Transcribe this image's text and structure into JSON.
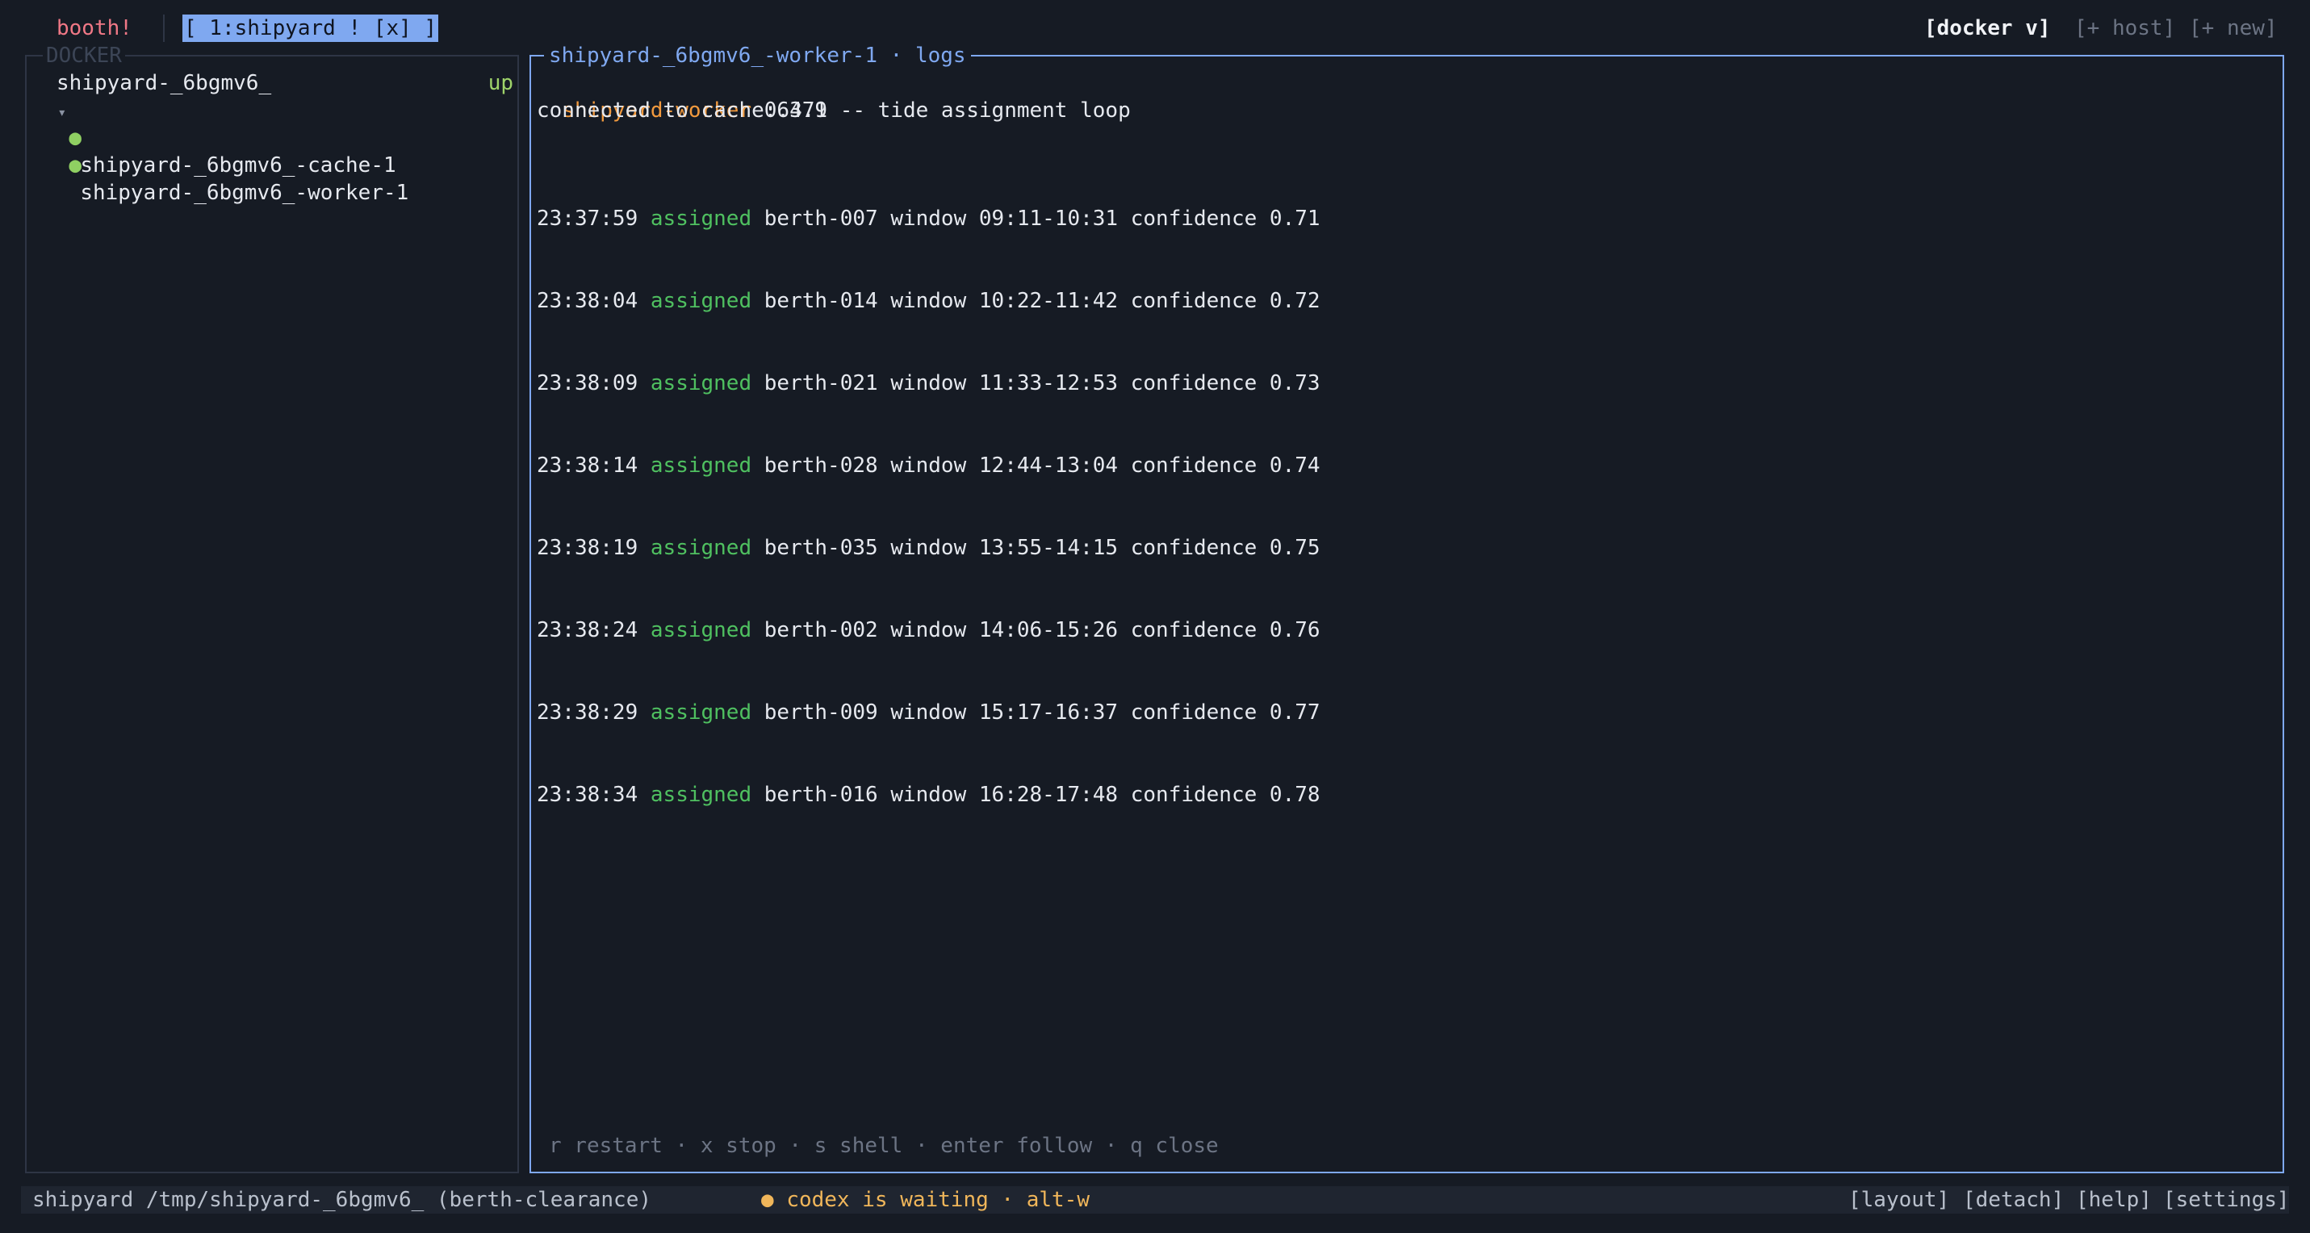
{
  "topbar": {
    "brand": "booth!",
    "active_tab": "[ 1:shipyard ! [x] ]",
    "docker_menu": "[docker v]",
    "add_host": "[+ host]",
    "add_new": "[+ new]"
  },
  "sidebar": {
    "section_title": "DOCKER",
    "project": {
      "name": "shipyard-_6bgmv6_",
      "status": "up",
      "arrow": "▾"
    },
    "containers": [
      {
        "name": "shipyard-_6bgmv6_-cache-1",
        "dot": "●"
      },
      {
        "name": "shipyard-_6bgmv6_-worker-1",
        "dot": "●"
      }
    ]
  },
  "logs": {
    "title": "shipyard-_6bgmv6_-worker-1 · logs",
    "header_app": "shipyard-worker",
    "header_rest": " 0.4.1 -- tide assignment loop",
    "connected": "connected to cache:6379",
    "entries": [
      {
        "time": "23:37:59",
        "action": "assigned",
        "rest": "berth-007 window 09:11-10:31 confidence 0.71"
      },
      {
        "time": "23:38:04",
        "action": "assigned",
        "rest": "berth-014 window 10:22-11:42 confidence 0.72"
      },
      {
        "time": "23:38:09",
        "action": "assigned",
        "rest": "berth-021 window 11:33-12:53 confidence 0.73"
      },
      {
        "time": "23:38:14",
        "action": "assigned",
        "rest": "berth-028 window 12:44-13:04 confidence 0.74"
      },
      {
        "time": "23:38:19",
        "action": "assigned",
        "rest": "berth-035 window 13:55-14:15 confidence 0.75"
      },
      {
        "time": "23:38:24",
        "action": "assigned",
        "rest": "berth-002 window 14:06-15:26 confidence 0.76"
      },
      {
        "time": "23:38:29",
        "action": "assigned",
        "rest": "berth-009 window 15:17-16:37 confidence 0.77"
      },
      {
        "time": "23:38:34",
        "action": "assigned",
        "rest": "berth-016 window 16:28-17:48 confidence 0.78"
      }
    ],
    "hints": {
      "restart": "r restart",
      "stop": "x stop",
      "shell": "s shell",
      "follow": "enter follow",
      "close": "q close",
      "sep": " · "
    }
  },
  "statusbar": {
    "path": "shipyard /tmp/shipyard-_6bgmv6_ (berth-clearance)",
    "waiting_dot": "●",
    "waiting": "codex is waiting · alt-w",
    "layout": "[layout]",
    "detach": "[detach]",
    "help": "[help]",
    "settings": "[settings]"
  },
  "colors": {
    "background": "#161b24",
    "accent": "#7fa8f0",
    "brand": "#f07886",
    "assigned": "#4fc060",
    "app_name": "#f29a3e",
    "up_status": "#9fd46a",
    "waiting": "#f0b65a"
  }
}
